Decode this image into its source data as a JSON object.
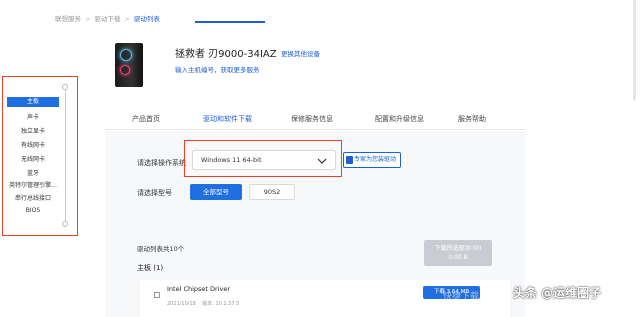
{
  "breadcrumb": [
    "联想服务",
    "驱动下载",
    "驱动列表"
  ],
  "product": {
    "name": "拯救者 刃9000-34IAZ",
    "change_device": "更换其他设备",
    "serial_link": "输入主机编号，获取更多服务"
  },
  "tabs": [
    {
      "label": "产品首页",
      "active": false
    },
    {
      "label": "驱动和软件下载",
      "active": true
    },
    {
      "label": "保修服务信息",
      "active": false
    },
    {
      "label": "配置和升级信息",
      "active": false
    },
    {
      "label": "服务帮助",
      "active": false
    }
  ],
  "sidebar": {
    "items": [
      "主板",
      "声卡",
      "独立显卡",
      "有线网卡",
      "无线网卡",
      "蓝牙",
      "英特尔管理引擎...",
      "串行总线接口",
      "BIOS"
    ],
    "active_index": 0
  },
  "os": {
    "label": "请选择操作系统",
    "selected": "Windows 11 64-bit",
    "expert_button": "专家为您装驱动"
  },
  "model": {
    "label": "请选择型号",
    "options": [
      "全部型号",
      "90S2"
    ],
    "selected_index": 0
  },
  "driver_list": {
    "count_text": "驱动列表共10个",
    "download_selected": "下载所选驱动 (0)",
    "download_selected_sub": "0.00 B",
    "group_title": "主板 (1)",
    "items": [
      {
        "name": "Intel Chipset Driver",
        "date": "2021/10/18",
        "version": "版本: 10.1.37.5",
        "download": "下载 3.64 MB"
      }
    ]
  },
  "watermark": {
    "text": "头条 @运维圈子",
    "logo": "快捷下载"
  },
  "colors": {
    "accent": "#1f6fe0",
    "highlight_border": "#e0452c",
    "disabled": "#c9cdd3"
  }
}
